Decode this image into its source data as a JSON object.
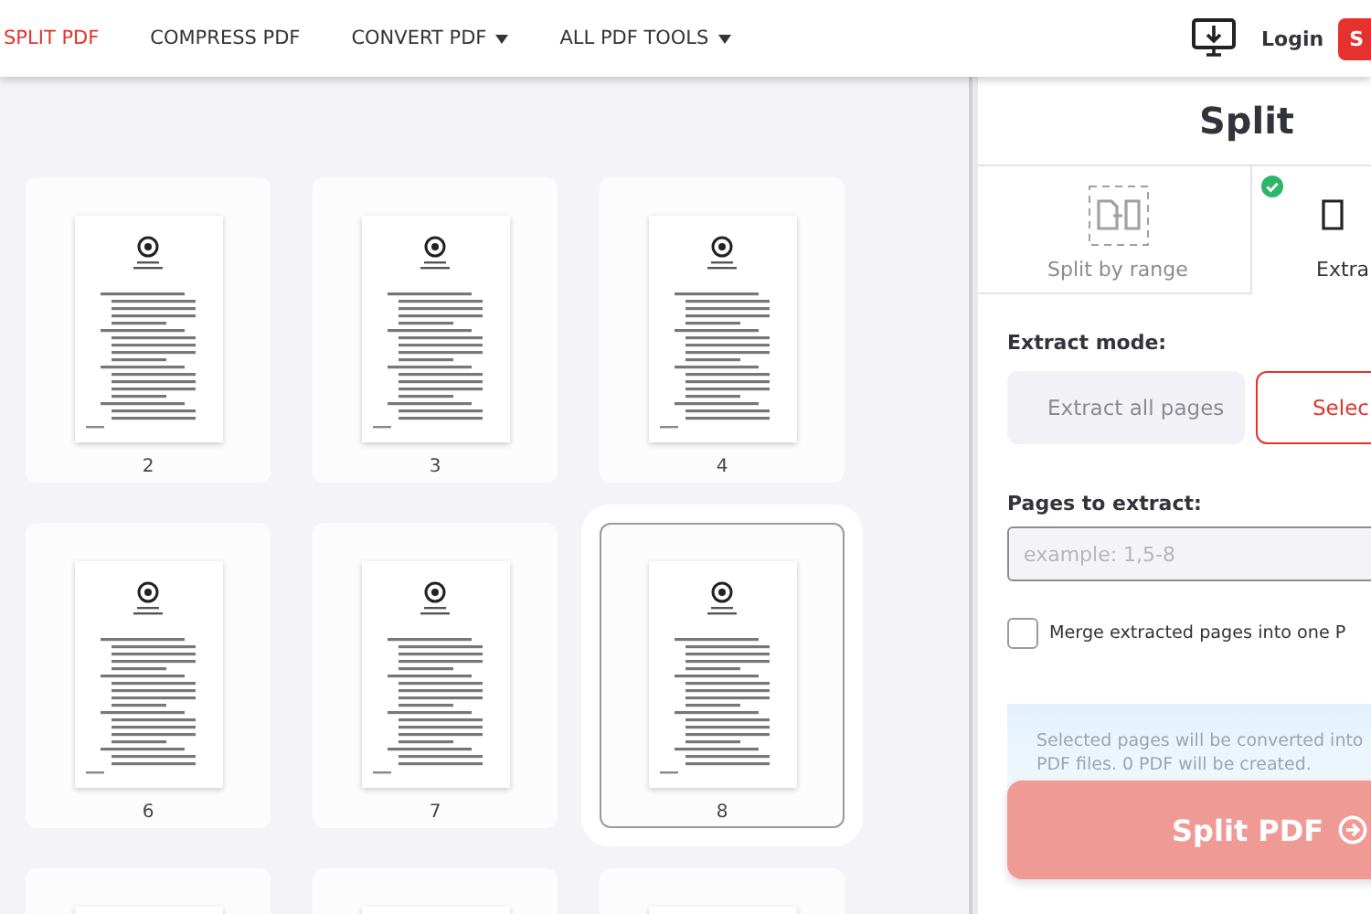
{
  "nav": {
    "items": [
      {
        "label": "SPLIT PDF",
        "selected": true,
        "dropdown": false
      },
      {
        "label": "COMPRESS PDF",
        "selected": false,
        "dropdown": false
      },
      {
        "label": "CONVERT PDF",
        "selected": false,
        "dropdown": true
      },
      {
        "label": "ALL PDF TOOLS",
        "selected": false,
        "dropdown": true
      }
    ],
    "login": "Login",
    "signup": "S"
  },
  "pages": [
    {
      "label": "2",
      "selected": false
    },
    {
      "label": "3",
      "selected": false
    },
    {
      "label": "4",
      "selected": false
    },
    {
      "label": "6",
      "selected": false
    },
    {
      "label": "7",
      "selected": false
    },
    {
      "label": "8",
      "selected": true
    },
    {
      "selected": false
    },
    {
      "selected": false
    },
    {
      "selected": false
    }
  ],
  "panel": {
    "title": "Split",
    "modes": [
      {
        "label": "Split by range",
        "kind": "range",
        "selected": false
      },
      {
        "label": "Extra",
        "kind": "extract",
        "selected": true
      }
    ],
    "extract_mode_label": "Extract mode:",
    "extract_options": [
      {
        "label": "Extract all pages",
        "selected": false
      },
      {
        "label": "Selec",
        "selected": true
      }
    ],
    "pages_label": "Pages to extract:",
    "pages_input": {
      "placeholder": "example: 1,5-8"
    },
    "merge": {
      "label": "Merge extracted pages into one P",
      "checked": false
    },
    "info": [
      "Selected pages will be converted into",
      "PDF files. 0 PDF will be created."
    ],
    "submit": "Split PDF"
  }
}
